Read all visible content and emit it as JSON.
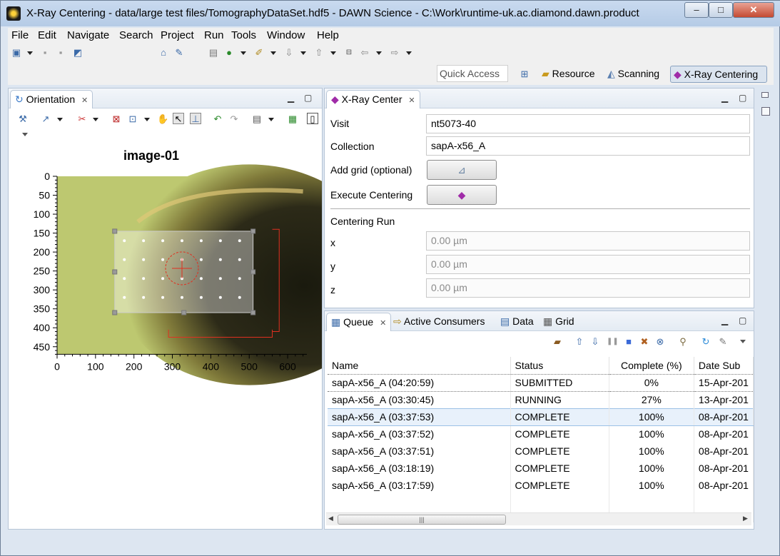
{
  "window": {
    "title": "X-Ray Centering - data/large test files/TomographyDataSet.hdf5 - DAWN Science - C:\\Work\\runtime-uk.ac.diamond.dawn.product",
    "controls": {
      "minimize": "–",
      "maximize": "□",
      "close": "✕"
    }
  },
  "menu": [
    "File",
    "Edit",
    "Navigate",
    "Search",
    "Project",
    "Run",
    "Tools",
    "Window",
    "Help"
  ],
  "quick_access": {
    "placeholder": "Quick Access"
  },
  "perspectives": [
    "Resource",
    "Scanning",
    "X-Ray Centering"
  ],
  "orientation_view": {
    "tab": "Orientation",
    "chart_data": {
      "type": "image",
      "title": "image-01",
      "x_ticks": [
        "0",
        "100",
        "200",
        "300",
        "400",
        "500",
        "600"
      ],
      "y_ticks": [
        "0",
        "50",
        "100",
        "150",
        "200",
        "250",
        "300",
        "350",
        "400",
        "450"
      ],
      "xlim": [
        0,
        650
      ],
      "ylim": [
        0,
        490
      ],
      "image_extent": {
        "x": [
          0,
          650
        ],
        "y": [
          0,
          470
        ]
      },
      "grid_region": {
        "x": [
          150,
          510
        ],
        "y": [
          145,
          360
        ]
      },
      "grid_points": {
        "columns": 7,
        "rows": 4,
        "x": [
          175,
          225,
          275,
          325,
          375,
          425,
          475
        ],
        "y": [
          170,
          220,
          270,
          320
        ]
      },
      "crosshair": {
        "x": 325,
        "y": 243
      },
      "colors": {
        "image_bg": "#bdc870",
        "overlay": "#ffffff",
        "marker": "#e03020"
      }
    }
  },
  "xray_center": {
    "tab": "X-Ray Center",
    "visit_label": "Visit",
    "visit_value": "nt5073-40",
    "collection_label": "Collection",
    "collection_value": "sapA-x56_A",
    "add_grid_label": "Add grid (optional)",
    "execute_label": "Execute Centering",
    "centering_run_label": "Centering Run",
    "x_label": "x",
    "x_placeholder": "0.00 µm",
    "y_label": "y",
    "y_placeholder": "0.00 µm",
    "z_label": "z",
    "z_placeholder": "0.00 µm"
  },
  "queue_view": {
    "tabs": [
      "Queue",
      "Active Consumers",
      "Data",
      "Grid"
    ],
    "columns": [
      "Name",
      "Status",
      "Complete (%)",
      "Date Sub"
    ],
    "rows": [
      {
        "name": "sapA-x56_A  (04:20:59)",
        "status": "SUBMITTED",
        "complete": "0%",
        "date": "15-Apr-201"
      },
      {
        "name": "sapA-x56_A  (03:30:45)",
        "status": "RUNNING",
        "complete": "27%",
        "date": "13-Apr-201"
      },
      {
        "name": "sapA-x56_A  (03:37:53)",
        "status": "COMPLETE",
        "complete": "100%",
        "date": "08-Apr-201"
      },
      {
        "name": "sapA-x56_A  (03:37:52)",
        "status": "COMPLETE",
        "complete": "100%",
        "date": "08-Apr-201"
      },
      {
        "name": "sapA-x56_A  (03:37:51)",
        "status": "COMPLETE",
        "complete": "100%",
        "date": "08-Apr-201"
      },
      {
        "name": "sapA-x56_A  (03:18:19)",
        "status": "COMPLETE",
        "complete": "100%",
        "date": "08-Apr-201"
      },
      {
        "name": "sapA-x56_A  (03:17:59)",
        "status": "COMPLETE",
        "complete": "100%",
        "date": "08-Apr-201"
      }
    ],
    "scroll_thumb": "|||"
  }
}
